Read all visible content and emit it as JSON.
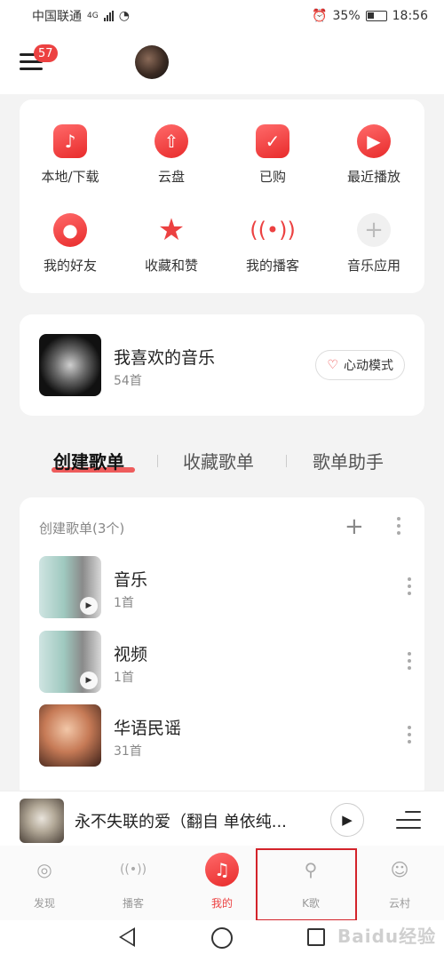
{
  "status_bar": {
    "carrier": "中国联通",
    "network": "4G",
    "battery": "35%",
    "time": "18:56"
  },
  "header": {
    "menu_badge": "57"
  },
  "quick_actions": [
    {
      "label": "本地/下载",
      "icon": "music-note-icon"
    },
    {
      "label": "云盘",
      "icon": "cloud-upload-icon"
    },
    {
      "label": "已购",
      "icon": "shopping-bag-icon"
    },
    {
      "label": "最近播放",
      "icon": "play-circle-icon"
    },
    {
      "label": "我的好友",
      "icon": "friends-icon"
    },
    {
      "label": "收藏和赞",
      "icon": "star-icon"
    },
    {
      "label": "我的播客",
      "icon": "podcast-icon"
    },
    {
      "label": "音乐应用",
      "icon": "plus-icon"
    }
  ],
  "favorites": {
    "title": "我喜欢的音乐",
    "count": "54首",
    "heart_mode": "心动模式"
  },
  "tabs": [
    "创建歌单",
    "收藏歌单",
    "歌单助手"
  ],
  "playlists": {
    "header": "创建歌单(3个)",
    "items": [
      {
        "name": "音乐",
        "count": "1首"
      },
      {
        "name": "视频",
        "count": "1首"
      },
      {
        "name": "华语民谣",
        "count": "31首"
      }
    ]
  },
  "player": {
    "title": "永不失联的爱（翻自 单依纯..."
  },
  "bottom_nav": [
    {
      "label": "发现",
      "icon": "discover-icon"
    },
    {
      "label": "播客",
      "icon": "podcast-icon"
    },
    {
      "label": "我的",
      "icon": "music-icon"
    },
    {
      "label": "K歌",
      "icon": "microphone-icon"
    },
    {
      "label": "云村",
      "icon": "community-icon"
    }
  ],
  "watermark": "Baidu经验",
  "colors": {
    "accent": "#ec4141",
    "highlight_box": "#d3232a"
  }
}
